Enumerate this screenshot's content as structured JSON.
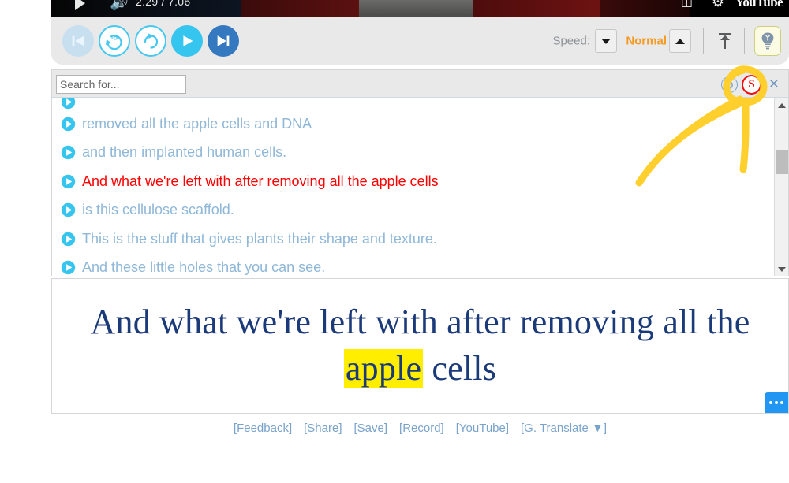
{
  "video": {
    "play_icon": "play-triangle-icon",
    "volume_icon": "volume-icon",
    "time": "2.29 / 7.06",
    "captions_icon": "closed-captions-icon",
    "settings_icon": "gear-icon",
    "brand": "YouTube"
  },
  "toolbar": {
    "buttons": [
      {
        "name": "previous-segment-button",
        "icon": "skip-back-icon",
        "label": "Previous"
      },
      {
        "name": "rewind-5-button",
        "icon": "replay-5-icon",
        "label": "-5"
      },
      {
        "name": "repeat-button",
        "icon": "repeat-icon",
        "label": "Repeat"
      },
      {
        "name": "play-button",
        "icon": "play-icon",
        "label": "Play"
      },
      {
        "name": "next-segment-button",
        "icon": "skip-forward-icon",
        "label": "Next"
      }
    ],
    "speed_label": "Speed:",
    "speed_value": "Normal",
    "speed_down_icon": "triangle-down-icon",
    "speed_up_icon": "triangle-up-icon",
    "upload_icon": "upload-arrow-icon",
    "bulb_icon": "lightbulb-icon"
  },
  "search": {
    "value": "",
    "placeholder": "Search for...",
    "refresh_icon": "refresh-icon",
    "s_icon": "circled-s-icon",
    "s_icon_letter": "S",
    "close_icon": "close-x-icon",
    "close_glyph": "×"
  },
  "transcript": {
    "lines": [
      {
        "text": "removed all the apple cells and DNA",
        "active": false
      },
      {
        "text": "and then implanted human cells.",
        "active": false
      },
      {
        "text": "And what we're left with after removing all the apple cells",
        "active": true
      },
      {
        "text": "is this cellulose scaffold.",
        "active": false
      },
      {
        "text": "This is the stuff that gives plants their shape and texture.",
        "active": false
      },
      {
        "text": "And these little holes that you can see.",
        "active": false
      }
    ],
    "scroll_up_icon": "scroll-up-arrow-icon",
    "scroll_down_icon": "scroll-down-arrow-icon"
  },
  "caption": {
    "before": "And what we're left with after removing all the ",
    "highlight": "apple",
    "after": " cells",
    "more_icon": "ellipsis-menu-icon"
  },
  "footer": {
    "links": [
      {
        "name": "feedback-link",
        "label": "[Feedback]"
      },
      {
        "name": "share-link",
        "label": "[Share]"
      },
      {
        "name": "save-link",
        "label": "[Save]"
      },
      {
        "name": "record-link",
        "label": "[Record]"
      },
      {
        "name": "youtube-link",
        "label": "[YouTube]"
      },
      {
        "name": "google-translate-link",
        "label": "[G. Translate  ▼]"
      }
    ]
  },
  "colors": {
    "accent_cyan": "#35c5ee",
    "accent_blue": "#3478c0",
    "active_line": "#ff0000",
    "speed_orange": "#f59a23",
    "highlight_yellow": "#ffee00",
    "caption_navy": "#1b3a7a",
    "annotation_yellow": "#ffcf2e",
    "s_icon_red": "#f01010"
  },
  "annotation": {
    "name": "hand-drawn-highlight-circle-and-arrow",
    "color": "#ffcf2e",
    "target": "circled-s-icon"
  }
}
